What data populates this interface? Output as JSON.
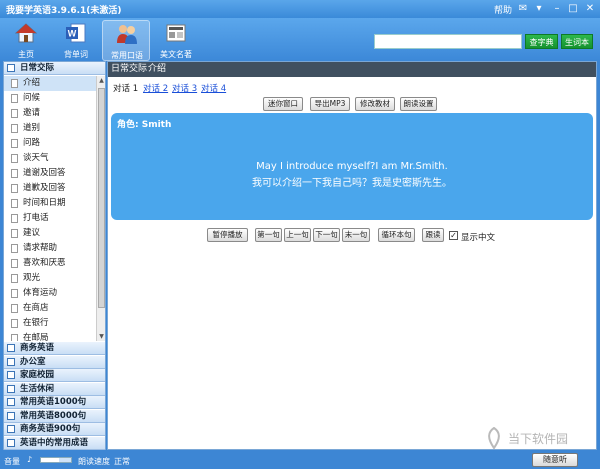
{
  "app": {
    "title": "我要学英语3.9.6.1(未激活)",
    "help": "帮助"
  },
  "toolbar": {
    "items": [
      {
        "label": "主页",
        "icon": "home-icon"
      },
      {
        "label": "背单词",
        "icon": "word-doc-icon"
      },
      {
        "label": "常用口语",
        "icon": "people-icon"
      },
      {
        "label": "美文名著",
        "icon": "newspaper-icon"
      }
    ],
    "search_placeholder": "",
    "search_button": "查字典",
    "dict_button": "生词本"
  },
  "sidebar": {
    "active_category": "日常交际",
    "subitems": [
      "介绍",
      "问候",
      "邀请",
      "道别",
      "问路",
      "谈天气",
      "道谢及回答",
      "道歉及回答",
      "时间和日期",
      "打电话",
      "建议",
      "请求帮助",
      "喜欢和厌恶",
      "观光",
      "体育运动",
      "在商店",
      "在银行",
      "在邮局"
    ],
    "categories": [
      "商务英语",
      "办公室",
      "家庭校园",
      "生活休闲",
      "常用英语1000句",
      "常用英语8000句",
      "商务英语900句",
      "英语中的常用成语"
    ]
  },
  "content": {
    "breadcrumb": [
      "日常交际",
      "介绍"
    ],
    "dialog_tabs": [
      "对话 1",
      "对话 2",
      "对话 3",
      "对话 4"
    ],
    "top_buttons": [
      "迷你窗口",
      "导出MP3",
      "修改教材",
      "朗读设置"
    ],
    "role": "角色: Smith",
    "english": "May I introduce myself?I am Mr.Smith.",
    "chinese": "我可以介绍一下我自己吗？我是史密斯先生。",
    "bottom_buttons": [
      "暂停播放",
      "第一句",
      "上一句",
      "下一句",
      "末一句",
      "循环本句",
      "跟读"
    ],
    "show_chinese": "显示中文"
  },
  "statusbar": {
    "volume_label": "音量",
    "speed_label": "朗读速度",
    "speed_value": "正常",
    "listen_button": "随意听"
  },
  "watermark": "当下软件园",
  "colors": {
    "accent": "#3d86d4",
    "panel": "#4aa6ec",
    "green": "#1ea63c"
  }
}
